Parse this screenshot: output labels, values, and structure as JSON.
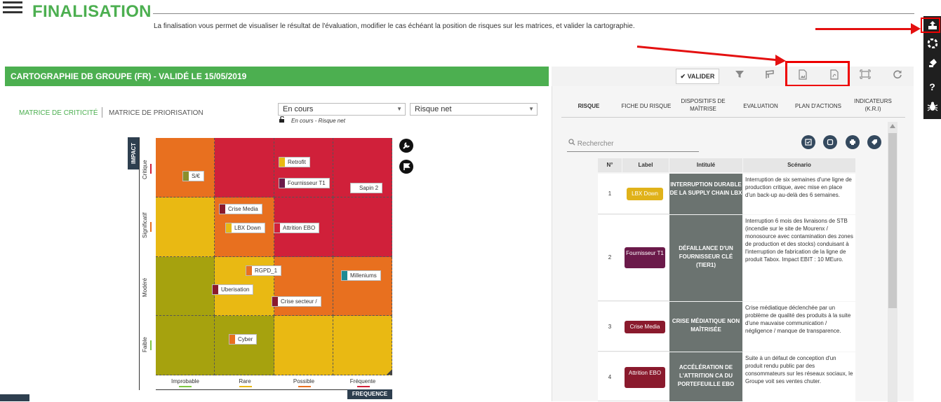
{
  "header": {
    "title": "FINALISATION",
    "subtitle": "La finalisation vous permet de visualiser le résultat de l'évaluation, modifier le cas échéant la position de risques sur les matrices, et valider la cartographie."
  },
  "right_toolbar": {
    "icons": [
      "export-icon",
      "help-ring-icon",
      "paint-icon",
      "question-icon",
      "bug-icon"
    ],
    "question_glyph": "?"
  },
  "section": {
    "title": "CARTOGRAPHIE DB GROUPE (FR) - VALIDÉ LE 15/05/2019",
    "valider_label": "VALIDER",
    "toolbar_icons": [
      "filter-icon",
      "layers-icon",
      "image-export-icon",
      "pdf-export-icon",
      "fullscreen-icon",
      "refresh-icon"
    ]
  },
  "matrix_tabs": {
    "criticite": "MATRICE DE CRITICITÉ",
    "priorisation": "MATRICE DE PRIORISATION"
  },
  "selects": {
    "status": "En cours",
    "risk_type": "Risque net",
    "note": "En cours - Risque net"
  },
  "matrix": {
    "axis_impact": "IMPACT",
    "axis_freq": "FREQUENCE",
    "rows": [
      "Critique",
      "Significatif",
      "Modéré",
      "Faible"
    ],
    "columns": [
      "Improbable",
      "Rare",
      "Possible",
      "Fréquente"
    ],
    "risks": {
      "r1": "S/€",
      "r2": "Retrofit",
      "r3": "Fournisseur T1",
      "r4": "Sapin 2",
      "r5": "Crise Media",
      "r6": "LBX Down",
      "r7": "Attrition EBO",
      "r8": "RGPD_1",
      "r9": "Uberisation",
      "r10": "Crise secteur /",
      "r11": "Milleniums",
      "r12": "Cyber"
    }
  },
  "panel": {
    "tabs": {
      "risque": "RISQUE",
      "fiche": "FICHE DU RISQUE",
      "dispositifs": "DISPOSITIFS DE MAÎTRISE",
      "evaluation": "EVALUATION",
      "plan": "PLAN D'ACTIONS",
      "indicateurs": "INDICATEURS (K.R.I)"
    },
    "search_placeholder": "Rechercher",
    "columns": {
      "num": "N°",
      "label": "Label",
      "intitule": "Intitulé",
      "scenario": "Scénario"
    },
    "rows": [
      {
        "num": "1",
        "label": "LBX Down",
        "intitule": "INTERRUPTION DURABLE DE LA SUPPLY CHAIN LBX",
        "scenario": "Interruption de six semaines d'une ligne de production critique, avec mise en place d'un back-up au-delà des 6 semaines."
      },
      {
        "num": "2",
        "label": "Fournisseur T1",
        "intitule": "DÉFAILLANCE D'UN FOURNISSEUR CLÉ (TIER1)",
        "scenario": "Interruption 6 mois des livraisons de STB (incendie sur le site de Mourenx / monosource avec contamination des zones de production et des stocks) conduisant à l'interruption de fabrication de la ligne de produit Tabox. Impact EBIT : 10 MEuro."
      },
      {
        "num": "3",
        "label": "Crise Media",
        "intitule": "CRISE MÉDIATIQUE NON MAÎTRISÉE",
        "scenario": "Crise médiatique déclenchée par un problème de qualité des produits à la suite d'une mauvaise communication / négligence / manque de transparence."
      },
      {
        "num": "4",
        "label": "Attrition EBO",
        "intitule": "ACCÉLÉRATION DE L'ATTRITION CA DU PORTEFEUILLE EBO",
        "scenario": "Suite à un défaut de conception d'un produit rendu public par des consommateurs sur les réseaux sociaux, le Groupe voit ses ventes chuter."
      }
    ]
  },
  "colors": {
    "brand_green": "#4CAF50",
    "matrix_orange": "#e8701f",
    "matrix_red": "#d0203a",
    "matrix_yellow": "#e9b913",
    "matrix_olive": "#a6a20e",
    "annotation_red": "#e41010"
  }
}
